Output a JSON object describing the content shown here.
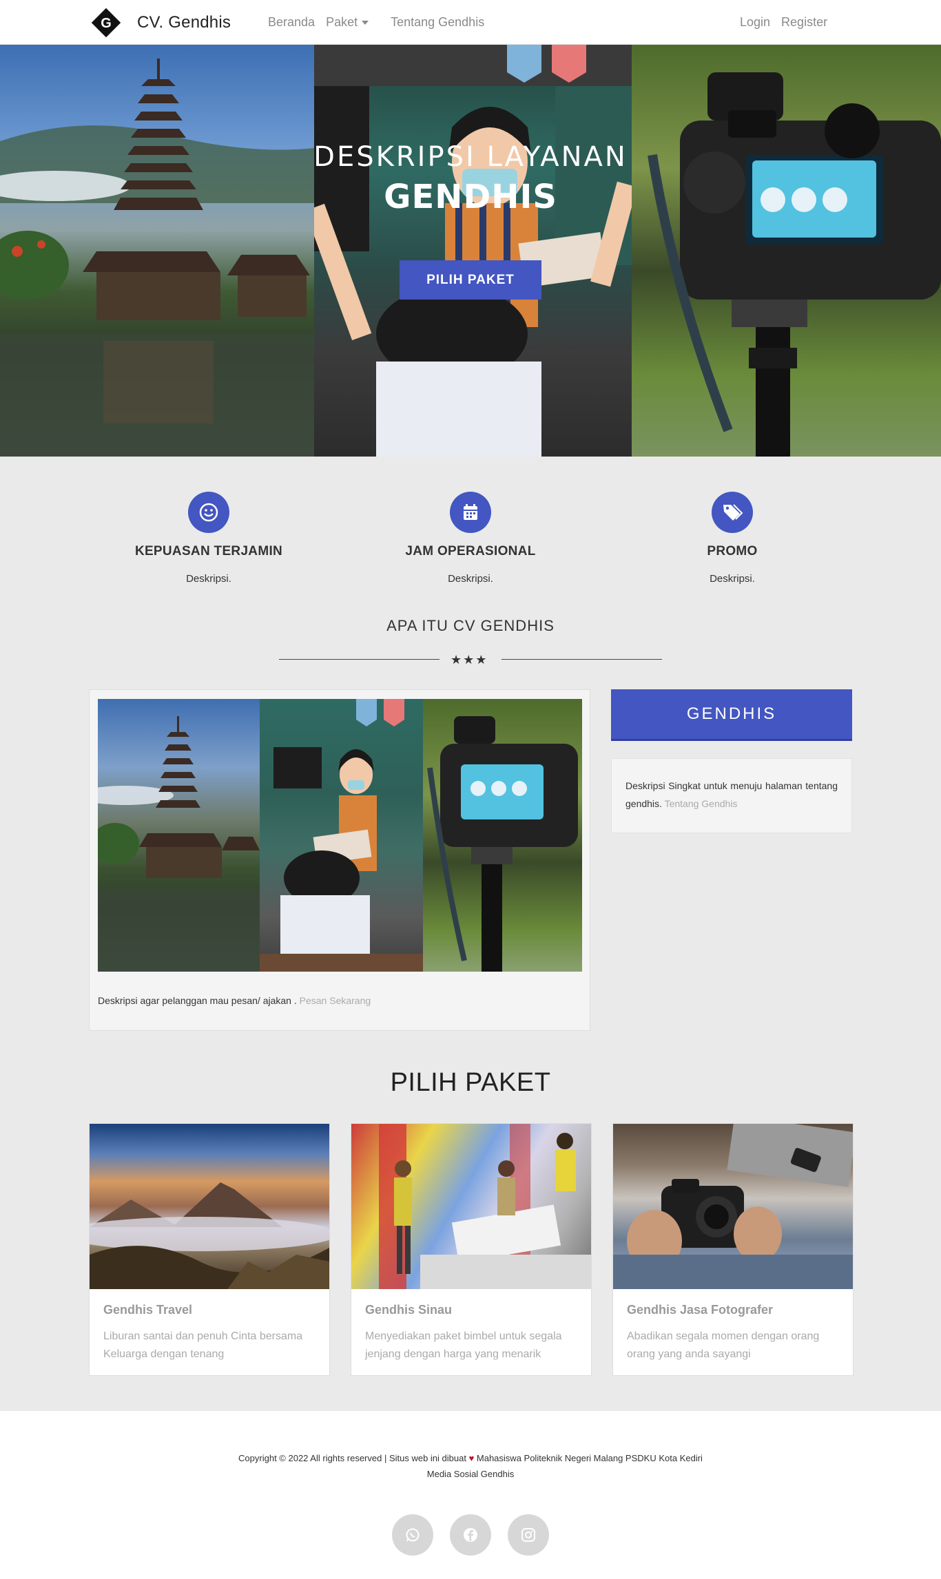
{
  "navbar": {
    "brand": "CV. Gendhis",
    "logo_glyph": "G",
    "links": [
      {
        "label": "Beranda"
      },
      {
        "label": "Paket"
      },
      {
        "label": "Tentang Gendhis"
      }
    ],
    "auth": [
      {
        "label": "Login"
      },
      {
        "label": "Register"
      }
    ]
  },
  "hero": {
    "title_line1": "DESKRIPSI  LAYANAN",
    "title_line2": "GENDHIS",
    "button": "PILIH PAKET"
  },
  "features": [
    {
      "icon": "smile-icon",
      "title": "KEPUASAN TERJAMIN",
      "desc": "Deskripsi."
    },
    {
      "icon": "calendar-icon",
      "title": "JAM OPERASIONAL",
      "desc": "Deskripsi."
    },
    {
      "icon": "tag-icon",
      "title": "PROMO",
      "desc": "Deskripsi."
    }
  ],
  "about": {
    "section_title": "APA ITU CV GENDHIS",
    "stars": "★★★",
    "text": "Deskripsi agar pelanggan mau pesan/ ajakan .",
    "link": "Pesan Sekarang"
  },
  "sidebar": {
    "title": "GENDHIS",
    "text": "Deskripsi Singkat untuk menuju halaman tentang gendhis.",
    "link": "Tentang Gendhis"
  },
  "packages": {
    "title": "PILIH PAKET",
    "items": [
      {
        "title": "Gendhis Travel",
        "desc": "Liburan santai dan penuh Cinta bersama Keluarga dengan tenang"
      },
      {
        "title": "Gendhis Sinau",
        "desc": "Menyediakan paket bimbel untuk segala jenjang dengan harga yang menarik"
      },
      {
        "title": "Gendhis Jasa Fotografer",
        "desc": "Abadikan segala momen dengan orang orang yang anda sayangi"
      }
    ]
  },
  "footer": {
    "copyright_before": "Copyright © 2022 All rights reserved | Situs web ini dibuat ",
    "heart": "♥",
    "copyright_after": " Mahasiswa Politeknik Negeri Malang PSDKU Kota Kediri",
    "social_label": "Media Sosial Gendhis",
    "social": [
      {
        "icon": "whatsapp-icon"
      },
      {
        "icon": "facebook-icon"
      },
      {
        "icon": "instagram-icon"
      }
    ]
  },
  "colors": {
    "accent": "#4356c1",
    "heart": "#b3192b",
    "background": "#eaeaea"
  }
}
